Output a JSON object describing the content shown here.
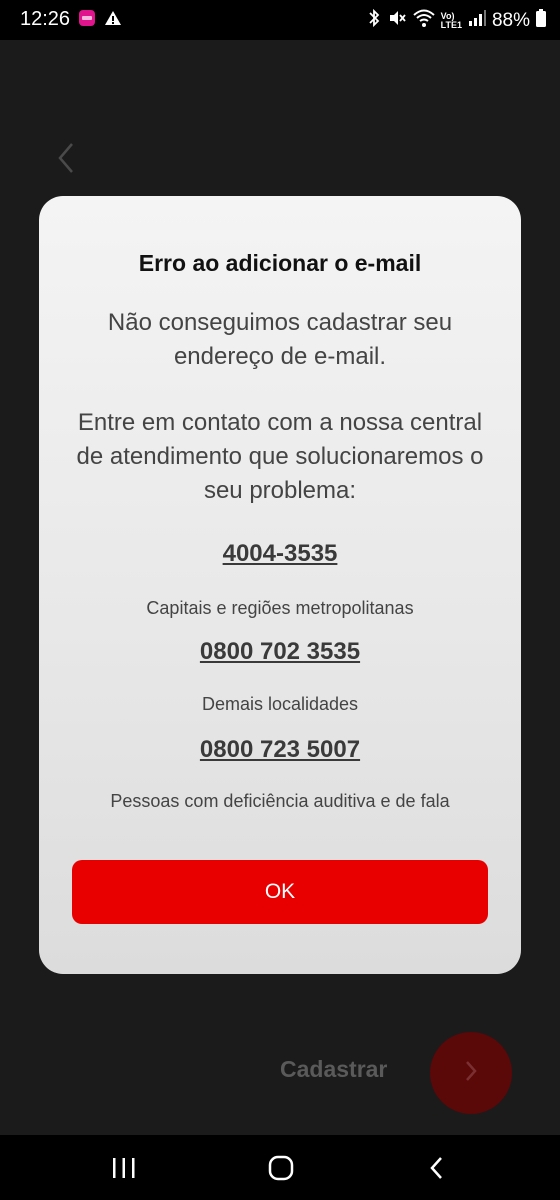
{
  "status_bar": {
    "time": "12:26",
    "battery_percent": "88%",
    "icons": [
      "notification-app-icon",
      "warning-icon",
      "bluetooth-icon",
      "mute-icon",
      "wifi-icon",
      "volte-lte-icon",
      "signal-icon",
      "battery-icon"
    ],
    "volte_label": "Vo)",
    "lte_label": "LTE1"
  },
  "background_screen": {
    "submit_label": "Cadastrar"
  },
  "modal": {
    "title": "Erro ao adicionar o e-mail",
    "message_1": "Não conseguimos cadastrar seu endereço de e-mail.",
    "message_2": "Entre em contato com a nossa central de atendimento que solucionaremos o seu problema:",
    "contacts": [
      {
        "phone": "4004-3535",
        "description": "Capitais e regiões metropolitanas"
      },
      {
        "phone": "0800 702 3535",
        "description": "Demais localidades"
      },
      {
        "phone": "0800 723 5007",
        "description": "Pessoas com deficiência auditiva e de fala"
      }
    ],
    "ok_label": "OK"
  },
  "colors": {
    "accent_red": "#e80000",
    "background": "#1b1b1b"
  }
}
